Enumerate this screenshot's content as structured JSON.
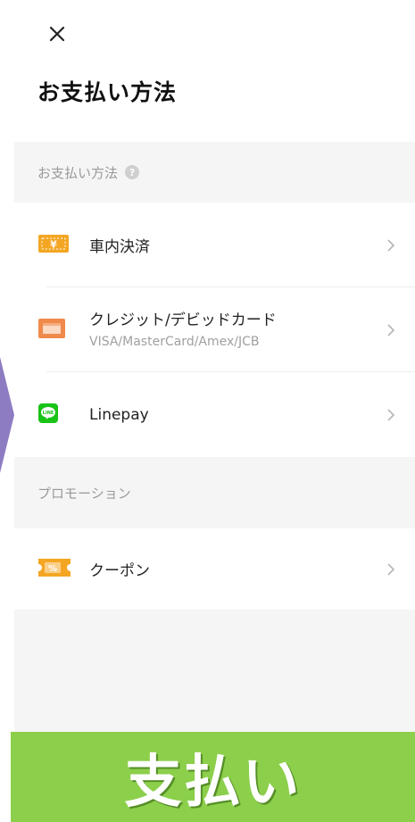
{
  "header": {
    "title": "お支払い方法"
  },
  "sections": {
    "payment": {
      "title": "お支払い方法",
      "help_glyph": "?"
    },
    "promotion": {
      "title": "プロモーション"
    }
  },
  "payment_methods": [
    {
      "label": "車内決済",
      "icon": "cash-icon",
      "icon_text": "¥",
      "color": "#f4a623"
    },
    {
      "label": "クレジット/デビッドカード",
      "sublabel": "VISA/MasterCard/Amex/JCB",
      "icon": "credit-card-icon",
      "color": "#f08a4b"
    },
    {
      "label": "Linepay",
      "icon": "line-icon",
      "icon_text": "LINE",
      "color": "#19c317"
    }
  ],
  "promotions": [
    {
      "label": "クーポン",
      "icon": "coupon-icon",
      "icon_text": "%",
      "color": "#f4a623"
    }
  ],
  "banner": {
    "text": "支払い",
    "color": "#8ccf4b"
  }
}
